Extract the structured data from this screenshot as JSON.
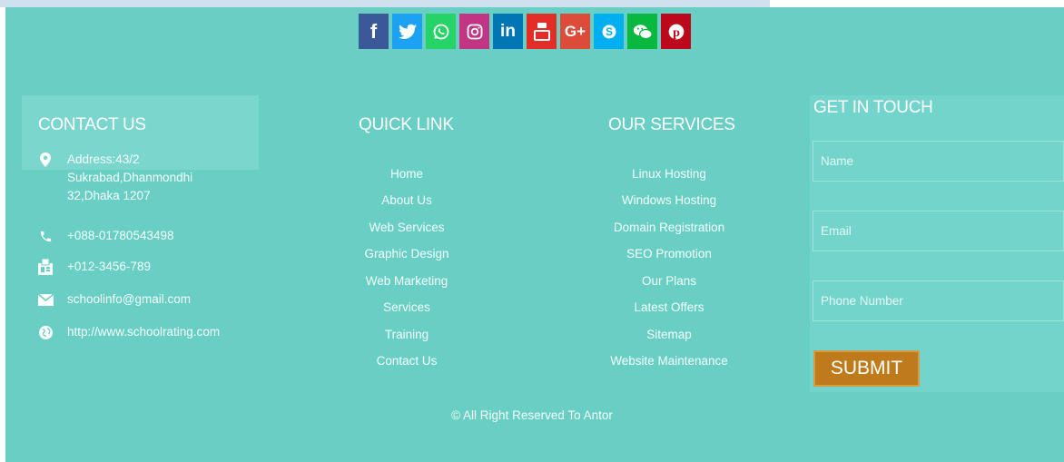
{
  "social": [
    {
      "name": "facebook",
      "glyph": "f",
      "color": "#3b5998"
    },
    {
      "name": "twitter",
      "glyph": "",
      "color": "#1da1f2"
    },
    {
      "name": "whatsapp",
      "glyph": "",
      "color": "#25d366"
    },
    {
      "name": "instagram",
      "glyph": "",
      "color": "#c13584"
    },
    {
      "name": "linkedin",
      "glyph": "in",
      "color": "#0077b5"
    },
    {
      "name": "youtube",
      "glyph": "",
      "color": "#e52d27"
    },
    {
      "name": "google-plus",
      "glyph": "G+",
      "color": "#dd4b39"
    },
    {
      "name": "skype",
      "glyph": "",
      "color": "#00aff0"
    },
    {
      "name": "wechat",
      "glyph": "",
      "color": "#09b83e"
    },
    {
      "name": "pinterest",
      "glyph": "",
      "color": "#bd081c"
    }
  ],
  "contact": {
    "title": "CONTACT US",
    "address": "Address:43/2 Sukrabad,Dhanmondhi 32,Dhaka 1207",
    "phone": "+088-01780543498",
    "fax": "+012-3456-789",
    "email": "schoolinfo@gmail.com",
    "website": "http://www.schoolrating.com"
  },
  "quick_link": {
    "title": "QUICK LINK",
    "items": [
      "Home",
      "About Us",
      "Web Services",
      "Graphic Design",
      "Web Marketing",
      "Services",
      "Training",
      "Contact Us"
    ]
  },
  "services": {
    "title": "OUR SERVICES",
    "items": [
      "Linux Hosting",
      "Windows Hosting",
      "Domain Registration",
      "SEO Promotion",
      "Our Plans",
      "Latest Offers",
      "Sitemap",
      "Website Maintenance"
    ]
  },
  "get_in_touch": {
    "title": "GET IN TOUCH",
    "name_placeholder": "Name",
    "email_placeholder": "Email",
    "phone_placeholder": "Phone Number",
    "submit_label": "SUBMIT"
  },
  "copyright": "© All Right Reserved To Antor",
  "colors": {
    "footer_bg": "#69cec3",
    "submit_bg": "#bf7b1b"
  }
}
